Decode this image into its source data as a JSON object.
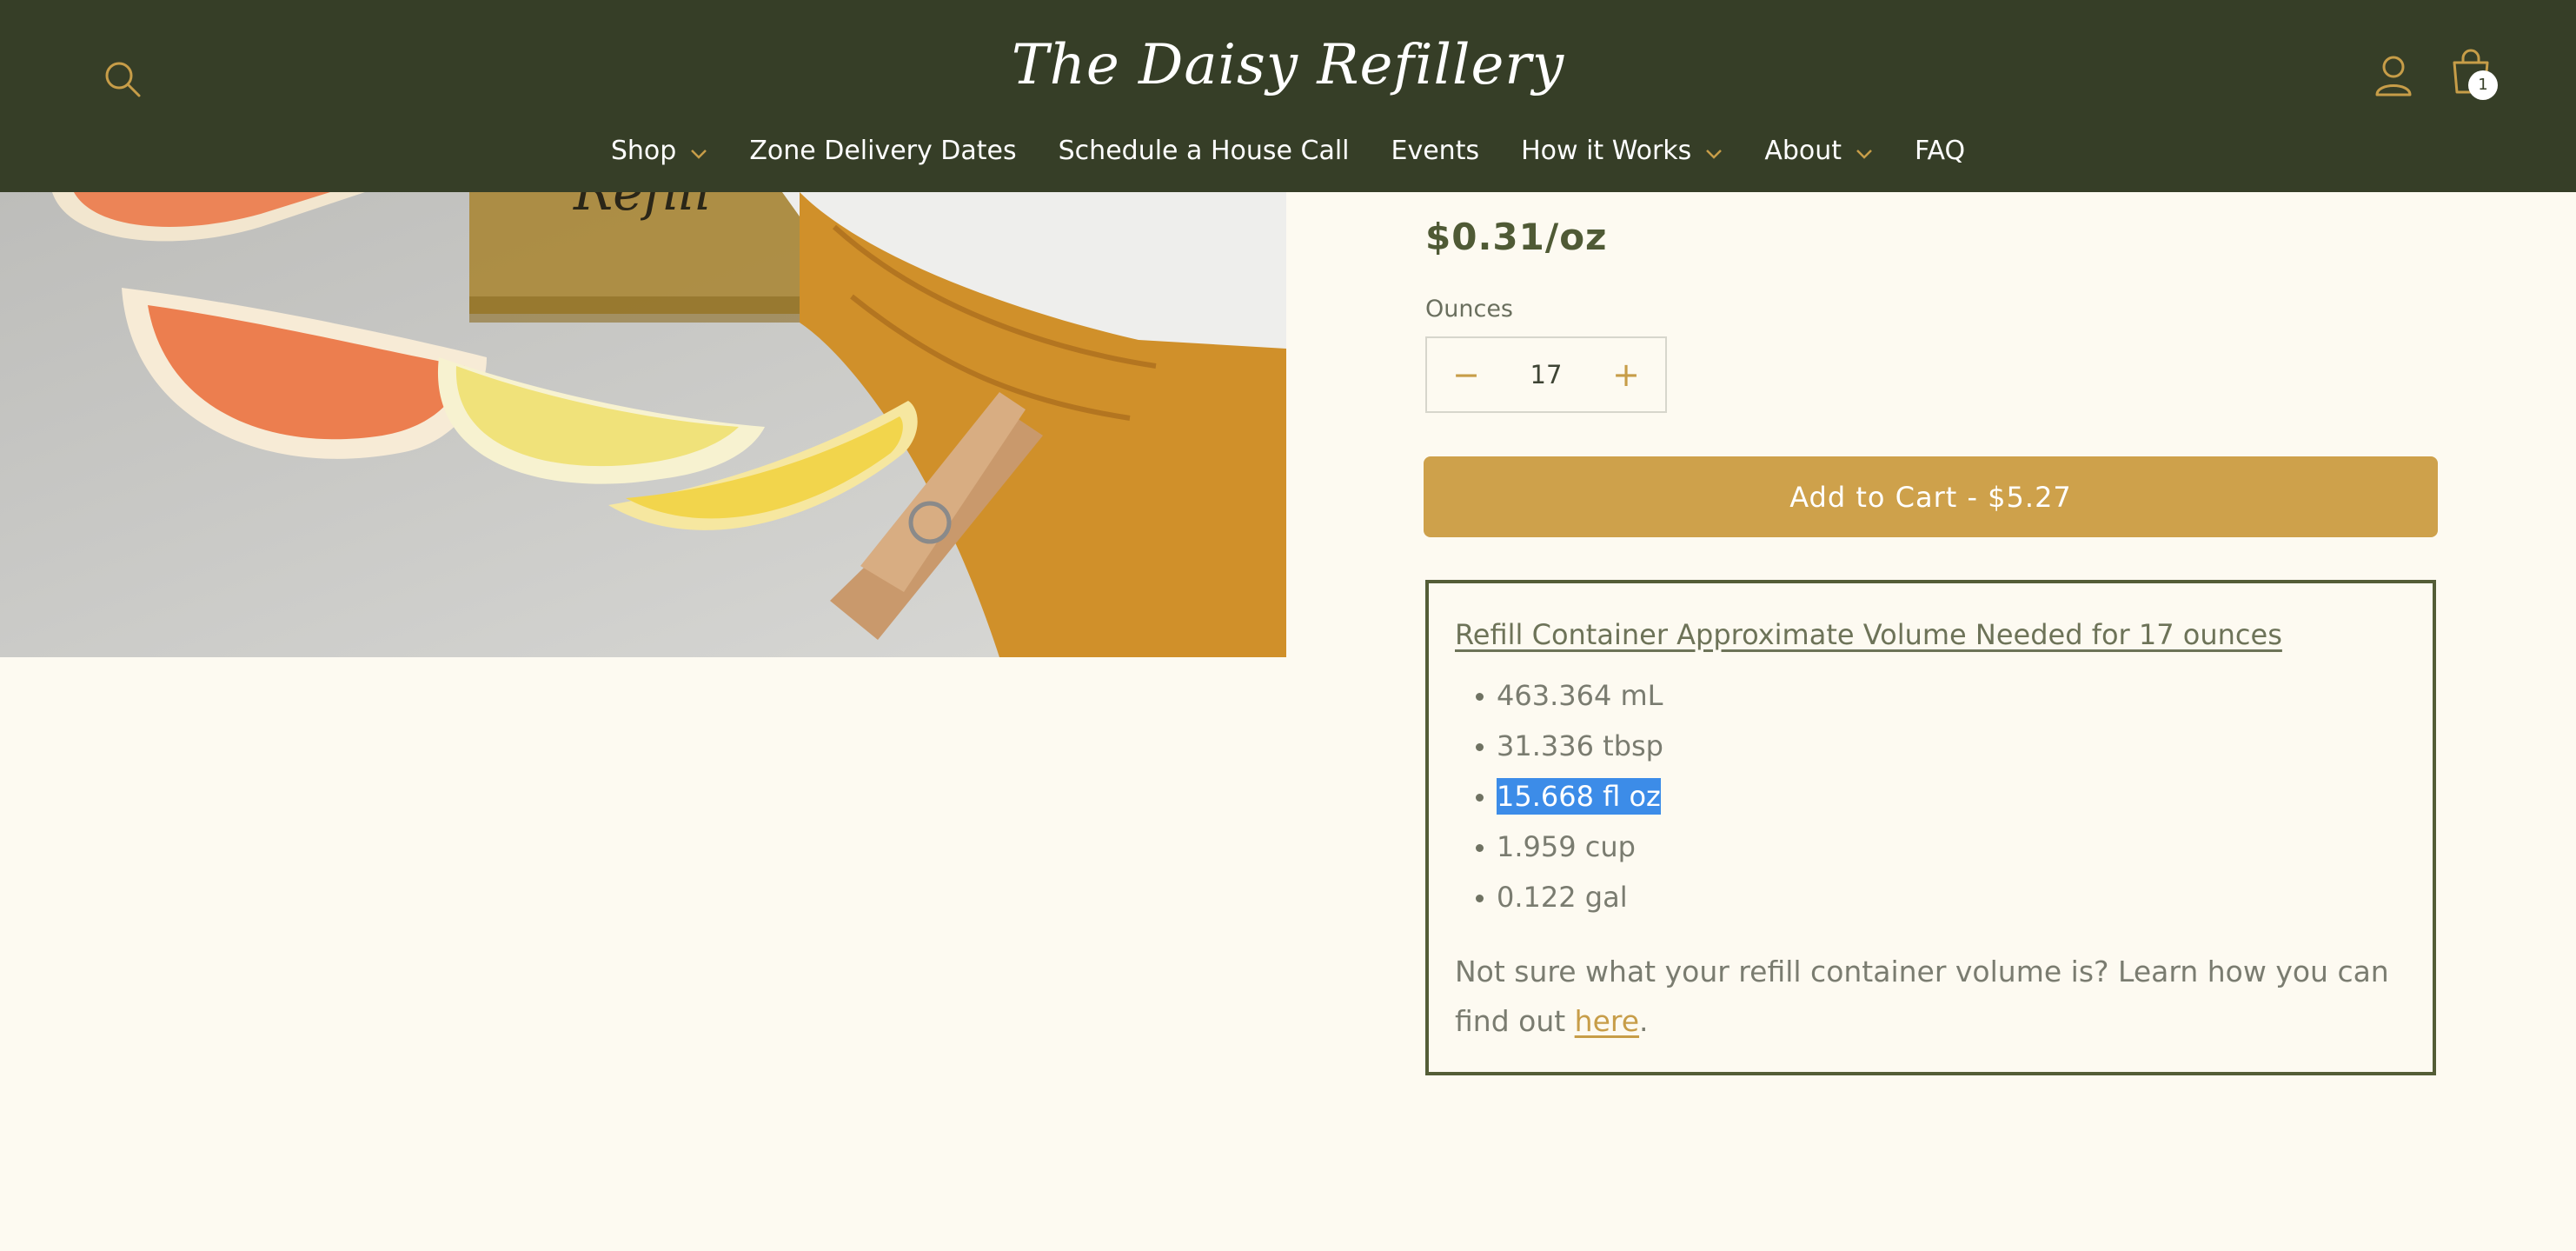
{
  "header": {
    "logo": "The Daisy Refillery",
    "icons": {
      "search": "search-icon",
      "account": "account-icon",
      "cart": "cart-icon"
    },
    "cart_count": "1",
    "nav": [
      {
        "label": "Shop",
        "dropdown": true
      },
      {
        "label": "Zone Delivery Dates",
        "dropdown": false
      },
      {
        "label": "Schedule a House Call",
        "dropdown": false
      },
      {
        "label": "Events",
        "dropdown": false
      },
      {
        "label": "How it Works",
        "dropdown": true
      },
      {
        "label": "About",
        "dropdown": true
      },
      {
        "label": "FAQ",
        "dropdown": false
      }
    ]
  },
  "product": {
    "price": "$0.31/oz",
    "quantity_label": "Ounces",
    "quantity": "17",
    "decrement_symbol": "−",
    "increment_symbol": "+",
    "add_to_cart": "Add to Cart - $5.27"
  },
  "volume_box": {
    "title": "Refill Container Approximate Volume Needed for 17 ounces",
    "items": [
      "463.364 mL",
      "31.336 tbsp",
      "15.668 fl oz",
      "1.959 cup",
      "0.122 gal"
    ],
    "highlighted_item": "15.668 fl oz",
    "note_text": "Not sure what your refill container volume is? Learn how you can find out ",
    "note_link": "here",
    "note_end": "."
  },
  "colors": {
    "header_bg": "#363e27",
    "page_bg": "#fdfaf1",
    "accent": "#cea14b",
    "box_border": "#545d37",
    "selection": "#3c8ce8"
  }
}
